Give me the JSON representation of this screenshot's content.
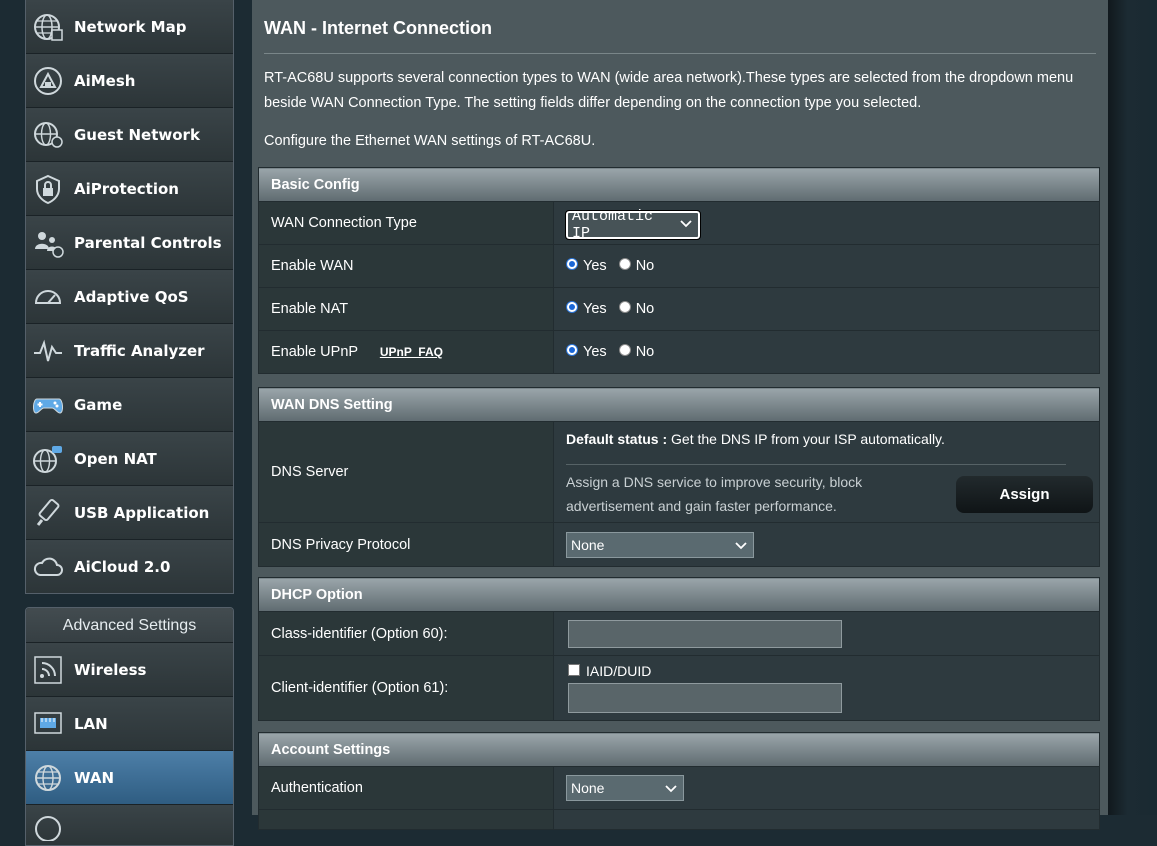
{
  "sidebar": {
    "general_items": [
      {
        "label": "Network Map",
        "icon": "network-map-icon"
      },
      {
        "label": "AiMesh",
        "icon": "aimesh-icon"
      },
      {
        "label": "Guest Network",
        "icon": "guest-network-icon"
      },
      {
        "label": "AiProtection",
        "icon": "aiprotection-icon"
      },
      {
        "label": "Parental Controls",
        "icon": "parental-controls-icon"
      },
      {
        "label": "Adaptive QoS",
        "icon": "adaptive-qos-icon"
      },
      {
        "label": "Traffic Analyzer",
        "icon": "traffic-analyzer-icon"
      },
      {
        "label": "Game",
        "icon": "game-icon"
      },
      {
        "label": "Open NAT",
        "icon": "open-nat-icon"
      },
      {
        "label": "USB Application",
        "icon": "usb-application-icon"
      },
      {
        "label": "AiCloud 2.0",
        "icon": "aicloud-icon"
      }
    ],
    "advanced_title": "Advanced Settings",
    "advanced_items": [
      {
        "label": "Wireless",
        "icon": "wireless-icon"
      },
      {
        "label": "LAN",
        "icon": "lan-icon"
      },
      {
        "label": "WAN",
        "icon": "wan-icon",
        "selected": true
      }
    ]
  },
  "main": {
    "title": "WAN - Internet Connection",
    "description": "RT-AC68U supports several connection types to WAN (wide area network).These types are selected from the dropdown menu beside WAN Connection Type. The setting fields differ depending on the connection type you selected.",
    "config_line": "Configure the Ethernet WAN settings of RT-AC68U.",
    "basic": {
      "header": "Basic Config",
      "wan_type_label": "WAN Connection Type",
      "wan_type_value": "Automatic IP",
      "enable_wan_label": "Enable WAN",
      "enable_nat_label": "Enable NAT",
      "enable_upnp_label": "Enable UPnP",
      "upnp_faq": "UPnP  FAQ",
      "yes": "Yes",
      "no": "No"
    },
    "dns": {
      "header": "WAN DNS Setting",
      "server_label": "DNS Server",
      "default_status_label": "Default status :",
      "default_status_text": " Get the DNS IP from your ISP automatically.",
      "assign_text": "Assign a DNS service to improve security, block advertisement and gain faster performance.",
      "assign_button": "Assign",
      "privacy_label": "DNS Privacy Protocol",
      "privacy_value": "None"
    },
    "dhcp": {
      "header": "DHCP Option",
      "class_label": "Class-identifier (Option 60):",
      "client_label": "Client-identifier (Option 61):",
      "iaid_label": "IAID/DUID"
    },
    "account": {
      "header": "Account Settings",
      "auth_label": "Authentication",
      "auth_value": "None"
    }
  },
  "colors": {
    "selected_item": "#3d6f98",
    "panel": "#4d595d",
    "header_grad_top": "#9aa5aa"
  }
}
